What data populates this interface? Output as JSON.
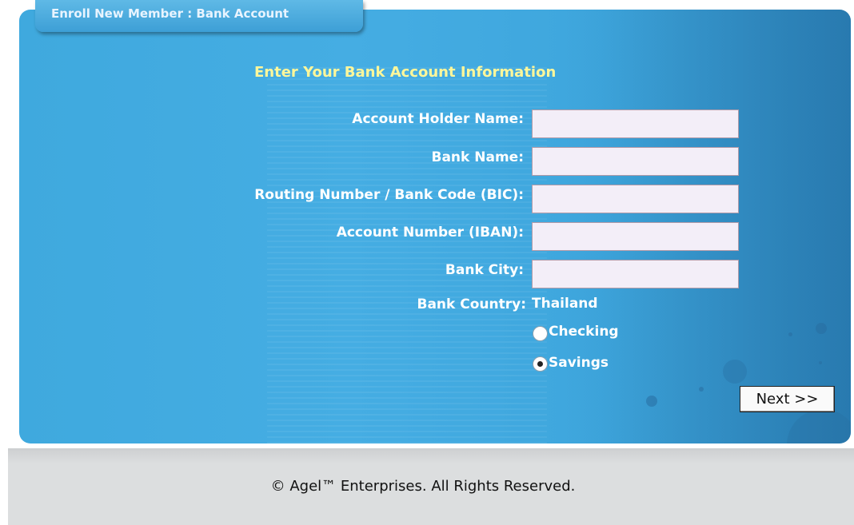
{
  "tab": {
    "title": "Enroll New Member : Bank Account"
  },
  "form": {
    "heading": "Enter Your Bank Account Information",
    "fields": [
      {
        "label": "Account Holder Name:",
        "value": ""
      },
      {
        "label": "Bank Name:",
        "value": ""
      },
      {
        "label": "Routing Number / Bank Code (BIC):",
        "value": ""
      },
      {
        "label": "Account Number (IBAN):",
        "value": ""
      },
      {
        "label": "Bank City:",
        "value": ""
      }
    ],
    "country": {
      "label": "Bank Country:",
      "value": "Thailand"
    },
    "account_type": {
      "options": [
        "Checking",
        "Savings"
      ],
      "selected": "Savings"
    },
    "next_label": "Next >>"
  },
  "footer": {
    "copyright": "© Agel™ Enterprises. All Rights Reserved."
  },
  "colors": {
    "panel": "#45ade3",
    "heading": "#fff79a",
    "field_bg": "#f3eef8",
    "footer_bg": "#dcdedf"
  }
}
